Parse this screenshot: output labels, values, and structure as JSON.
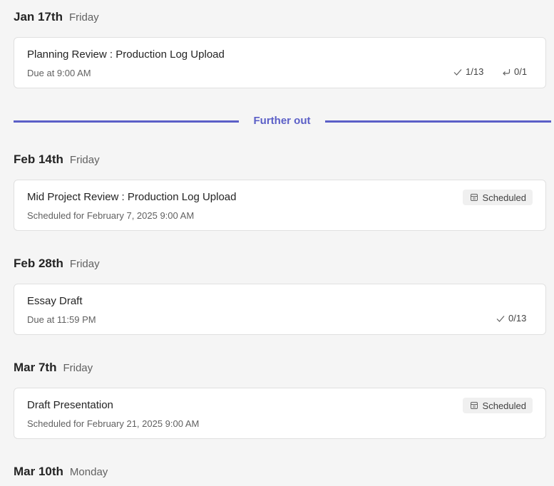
{
  "groups": [
    {
      "date": "Jan 17th",
      "day": "Friday",
      "card": {
        "title": "Planning Review : Production Log Upload",
        "subtitle": "Due at 9:00 AM",
        "turned_in": "1/13",
        "returned": "0/1"
      }
    },
    {
      "date": "Feb 14th",
      "day": "Friday",
      "card": {
        "title": "Mid Project Review : Production Log Upload",
        "subtitle": "Scheduled for February 7, 2025 9:00 AM",
        "badge": "Scheduled"
      }
    },
    {
      "date": "Feb 28th",
      "day": "Friday",
      "card": {
        "title": "Essay Draft",
        "subtitle": "Due at 11:59 PM",
        "turned_in": "0/13"
      }
    },
    {
      "date": "Mar 7th",
      "day": "Friday",
      "card": {
        "title": "Draft Presentation",
        "subtitle": "Scheduled for February 21, 2025 9:00 AM",
        "badge": "Scheduled"
      }
    },
    {
      "date": "Mar 10th",
      "day": "Monday"
    }
  ],
  "divider": {
    "label": "Further out"
  },
  "icons": {
    "turned_in": "checkmark-icon",
    "returned": "return-arrow-icon",
    "badge": "calendar-icon"
  },
  "colors": {
    "accent": "#5b5fc7",
    "background": "#f5f5f5",
    "card": "#ffffff",
    "badge_bg": "#f0f0f0"
  }
}
